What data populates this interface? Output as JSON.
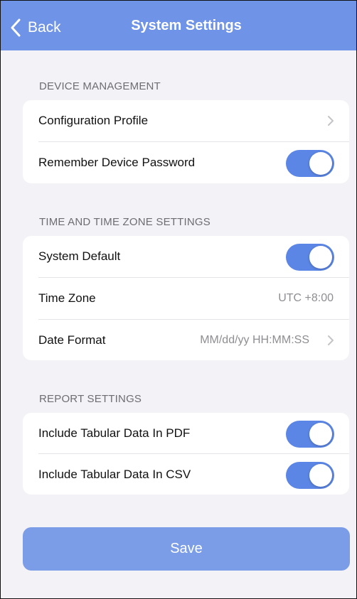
{
  "colors": {
    "nav_bar": "#6f93e6",
    "toggle_on": "#5b86e5",
    "save_button": "#7b9de8",
    "background": "#f2f2f7"
  },
  "navbar": {
    "back_label": "Back",
    "title": "System Settings"
  },
  "sections": [
    {
      "header": "DEVICE MANAGEMENT",
      "rows": [
        {
          "label": "Configuration Profile",
          "accessory": "chevron-right-icon"
        },
        {
          "label": "Remember Device Password",
          "toggle_on": true
        }
      ]
    },
    {
      "header": "TIME AND TIME ZONE SETTINGS",
      "rows": [
        {
          "label": "System Default",
          "toggle_on": true
        },
        {
          "label": "Time Zone",
          "value": "UTC +8:00"
        },
        {
          "label": "Date Format",
          "value": "MM/dd/yy HH:MM:SS",
          "accessory": "chevron-right-icon"
        }
      ]
    },
    {
      "header": "REPORT SETTINGS",
      "rows": [
        {
          "label": "Include Tabular Data In PDF",
          "toggle_on": true
        },
        {
          "label": "Include Tabular Data In CSV",
          "toggle_on": true
        }
      ]
    }
  ],
  "save_label": "Save"
}
